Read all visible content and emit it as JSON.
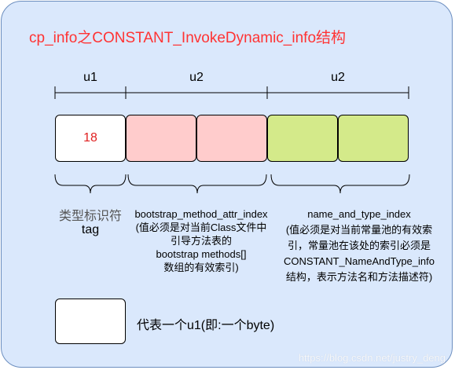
{
  "title": "cp_info之CONSTANT_InvokeDynamic_info结构",
  "columns": [
    {
      "label": "u1"
    },
    {
      "label": "u2"
    },
    {
      "label": "u2"
    }
  ],
  "tag_value": "18",
  "descriptions": {
    "tag": {
      "line1": "类型标识符",
      "line2": "tag"
    },
    "bootstrap": {
      "line1": "bootstrap_method_attr_index",
      "line2": "(值必须是对当前Class文件中",
      "line3": "引导方法表的",
      "line4": "bootstrap methods[]",
      "line5": "数组的有效索引)"
    },
    "name_and_type": {
      "line1": "name_and_type_index",
      "line2": "(值必须是对当前常量池的有效索",
      "line3": "引，常量池在该处的索引必须是",
      "line4": "CONSTANT_NameAndType_info",
      "line5": "结构，表示方法名和方法描述符)"
    }
  },
  "legend": {
    "text": "代表一个u1(即:一个byte)"
  },
  "watermark": "https://blog.csdn.net/justry_deng",
  "colors": {
    "panel": "#dae8fc",
    "title": "#ff3333",
    "pink": "#ffcccc",
    "green": "#d4ea8a"
  }
}
